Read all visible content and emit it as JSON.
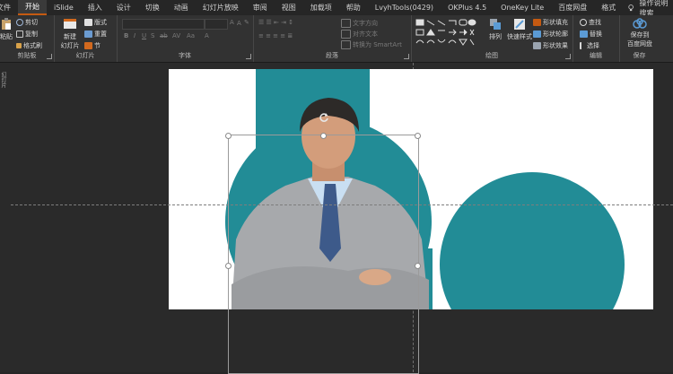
{
  "tabs": [
    "文件",
    "开始",
    "iSlide",
    "插入",
    "设计",
    "切换",
    "动画",
    "幻灯片放映",
    "审阅",
    "视图",
    "加载项",
    "帮助",
    "LvyhTools(0429)",
    "OKPlus 4.5",
    "OneKey Lite",
    "百度网盘",
    "格式"
  ],
  "active_tab": "开始",
  "tell_me": "操作说明搜索",
  "clipboard": {
    "paste": "粘贴",
    "cut": "剪切",
    "copy": "复制",
    "format_painter": "格式刷",
    "label": "剪贴板"
  },
  "slides": {
    "new_slide": "新建",
    "new_slide2": "幻灯片",
    "layout": "版式",
    "reset": "重置",
    "section": "节",
    "label": "幻灯片"
  },
  "font": {
    "label": "字体"
  },
  "paragraph": {
    "text_direction": "文字方向",
    "align_text": "对齐文本",
    "smartart": "转换为 SmartArt",
    "label": "段落"
  },
  "drawing": {
    "arrange": "排列",
    "quick_styles": "快速样式",
    "fill": "形状填充",
    "outline": "形状轮廓",
    "effects": "形状效果",
    "label": "绘图"
  },
  "editing": {
    "find": "查找",
    "replace": "替换",
    "select": "选择",
    "label": "编辑"
  },
  "save": {
    "save1": "保存到",
    "save2": "百度网盘",
    "label": "保存"
  },
  "colors": {
    "teal": "#228c96",
    "accent_tab": "#c55a11",
    "ribbon": "#323232",
    "workspace": "#2a2a2a"
  }
}
